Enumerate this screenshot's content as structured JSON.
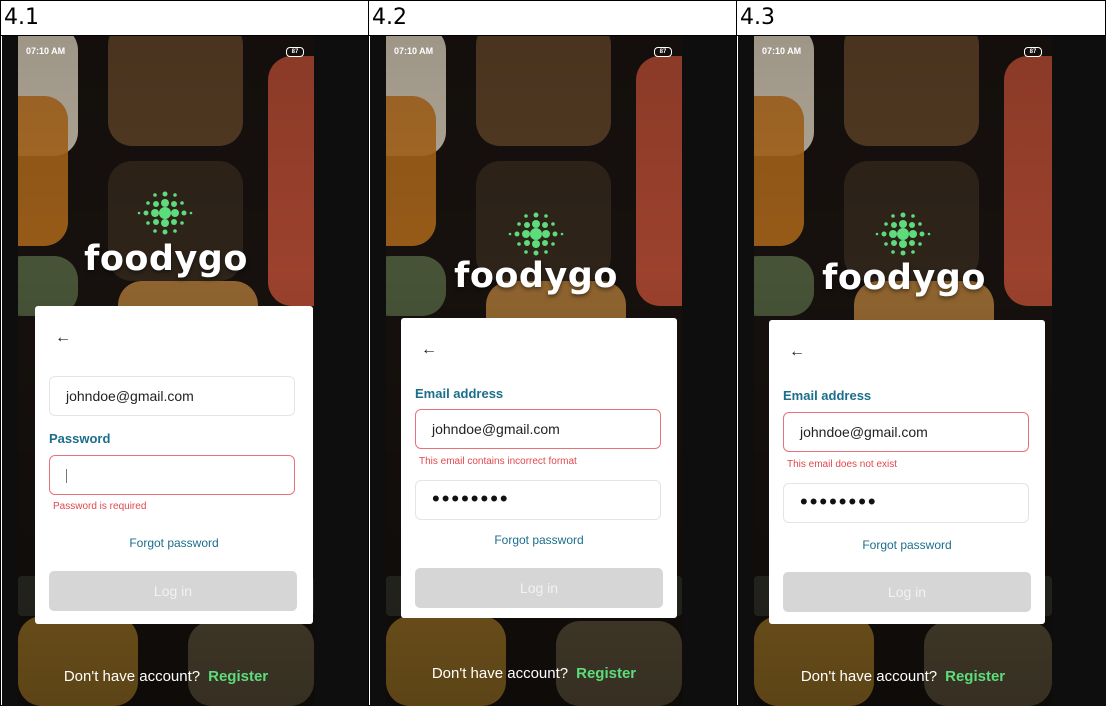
{
  "colors": {
    "accent": "#1b6e8c",
    "error": "#e0484f",
    "error_border": "#e8727a",
    "register": "#5ddc7c",
    "logo_green": "#5ddc7c",
    "button_disabled": "#d6d6d6"
  },
  "panels": [
    {
      "label": "4.1",
      "status_time": "07:10 AM",
      "battery": "87",
      "brand": "foodygo",
      "email_label": "",
      "email_value": "johndoe@gmail.com",
      "email_error": "",
      "password_label": "Password",
      "password_value": "",
      "password_error": "Password is required",
      "forgot_password": "Forgot password",
      "login_button": "Log in",
      "no_account": "Don't have account?",
      "register": "Register"
    },
    {
      "label": "4.2",
      "status_time": "07:10 AM",
      "battery": "87",
      "brand": "foodygo",
      "email_label": "Email address",
      "email_value": "johndoe@gmail.com",
      "email_error": "This email contains incorrect format",
      "password_label": "",
      "password_value": "••••••••",
      "password_error": "",
      "forgot_password": "Forgot password",
      "login_button": "Log in",
      "no_account": "Don't have account?",
      "register": "Register"
    },
    {
      "label": "4.3",
      "status_time": "07:10 AM",
      "battery": "87",
      "brand": "foodygo",
      "email_label": "Email address",
      "email_value": "johndoe@gmail.com",
      "email_error": "This email does not exist",
      "password_label": "",
      "password_value": "••••••••",
      "password_error": "",
      "forgot_password": "Forgot password",
      "login_button": "Log in",
      "no_account": "Don't have account?",
      "register": "Register"
    }
  ]
}
